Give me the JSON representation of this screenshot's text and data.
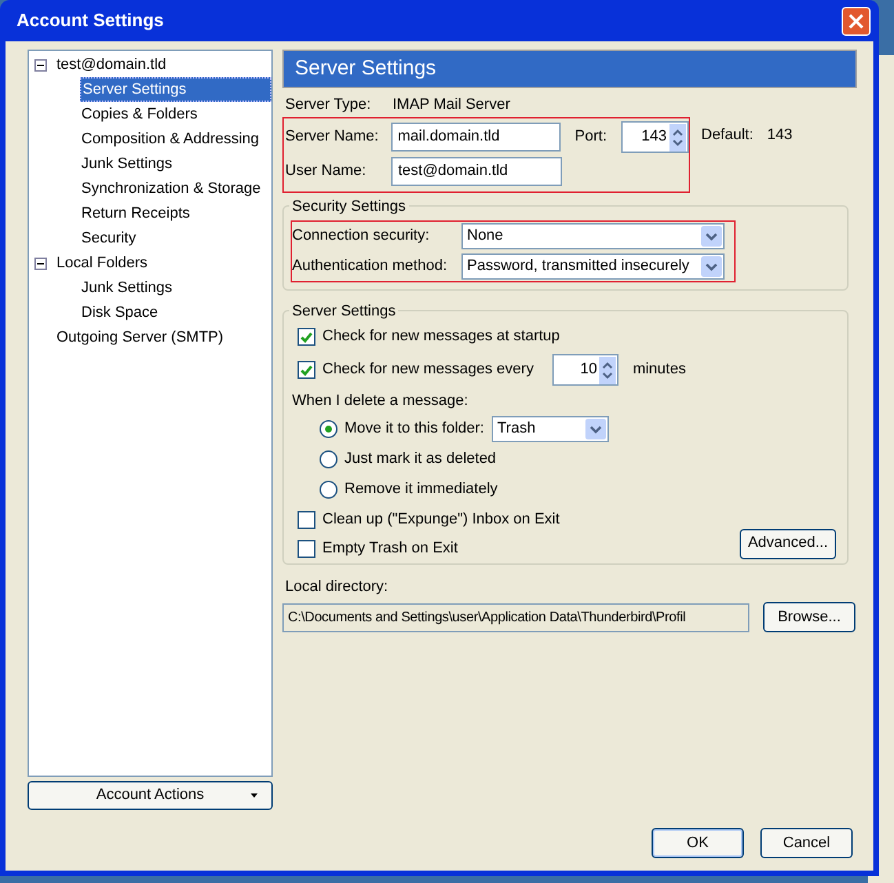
{
  "window": {
    "title": "Account Settings"
  },
  "tree": [
    {
      "label": "test@domain.tld",
      "expanded": true,
      "selected": false,
      "children": [
        {
          "label": "Server Settings",
          "selected": true
        },
        {
          "label": "Copies & Folders",
          "selected": false
        },
        {
          "label": "Composition & Addressing",
          "selected": false
        },
        {
          "label": "Junk Settings",
          "selected": false
        },
        {
          "label": "Synchronization & Storage",
          "selected": false
        },
        {
          "label": "Return Receipts",
          "selected": false
        },
        {
          "label": "Security",
          "selected": false
        }
      ]
    },
    {
      "label": "Local Folders",
      "expanded": true,
      "selected": false,
      "children": [
        {
          "label": "Junk Settings",
          "selected": false
        },
        {
          "label": "Disk Space",
          "selected": false
        }
      ]
    },
    {
      "label": "Outgoing Server (SMTP)",
      "selected": false
    }
  ],
  "account_actions": "Account Actions",
  "header": "Server Settings",
  "server_type": {
    "label": "Server Type:",
    "value": "IMAP Mail Server"
  },
  "server_name": {
    "label": "Server Name:",
    "value": "mail.domain.tld"
  },
  "port": {
    "label": "Port:",
    "value": "143"
  },
  "default": {
    "label": "Default:",
    "value": "143"
  },
  "user_name": {
    "label": "User Name:",
    "value": "test@domain.tld"
  },
  "security": {
    "title": "Security Settings",
    "fields": [
      {
        "label": "Connection security:",
        "value": "None"
      },
      {
        "label": "Authentication method:",
        "value": "Password, transmitted insecurely"
      }
    ]
  },
  "server_settings": {
    "title": "Server Settings",
    "check_startup": {
      "label": "Check for new messages at startup",
      "checked": true
    },
    "check_every": {
      "label": "Check for new messages every",
      "checked": true,
      "value": "10",
      "unit": "minutes"
    },
    "delete_label": "When I delete a message:",
    "delete_options": [
      {
        "label": "Move it to this folder:",
        "selected": true,
        "folder": "Trash"
      },
      {
        "label": "Just mark it as deleted",
        "selected": false
      },
      {
        "label": "Remove it immediately",
        "selected": false
      }
    ],
    "cleanup": {
      "label": "Clean up (\"Expunge\") Inbox on Exit",
      "checked": false
    },
    "empty_trash": {
      "label": "Empty Trash on Exit",
      "checked": false
    },
    "advanced": "Advanced..."
  },
  "local_directory": {
    "label": "Local directory:",
    "value": "C:\\Documents and Settings\\user\\Application Data\\Thunderbird\\Profil",
    "browse": "Browse..."
  },
  "buttons": [
    "OK",
    "Cancel"
  ]
}
